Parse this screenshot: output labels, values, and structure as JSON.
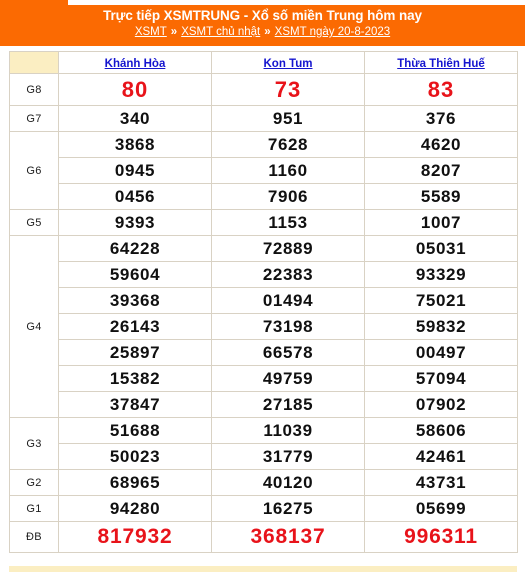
{
  "banner": {
    "title": "Trực tiếp XSMTRUNG - Xổ số miền Trung hôm nay",
    "breadcrumb": [
      {
        "label": "XSMT"
      },
      {
        "label": "XSMT chủ nhật"
      },
      {
        "label": "XSMT ngày 20-8-2023"
      }
    ],
    "separator": "»",
    "background_color": "#fb6a02",
    "text_color": "#ffffff"
  },
  "table": {
    "header": {
      "label_column": "",
      "provinces": [
        "Khánh Hòa",
        "Kon Tum",
        "Thừa Thiên Huế"
      ],
      "background_color": "#fbeec2",
      "link_color": "#1515cf"
    },
    "highlight_color": "#e8131a",
    "prize_rows": [
      {
        "label": "G8",
        "style": "red",
        "values": [
          [
            "80"
          ],
          [
            "73"
          ],
          [
            "83"
          ]
        ]
      },
      {
        "label": "G7",
        "style": "normal",
        "values": [
          [
            "340"
          ],
          [
            "951"
          ],
          [
            "376"
          ]
        ]
      },
      {
        "label": "G6",
        "style": "normal",
        "values": [
          [
            "3868",
            "0945",
            "0456"
          ],
          [
            "7628",
            "1160",
            "7906"
          ],
          [
            "4620",
            "8207",
            "5589"
          ]
        ]
      },
      {
        "label": "G5",
        "style": "normal",
        "values": [
          [
            "9393"
          ],
          [
            "1153"
          ],
          [
            "1007"
          ]
        ]
      },
      {
        "label": "G4",
        "style": "normal",
        "values": [
          [
            "64228",
            "59604",
            "39368",
            "26143",
            "25897",
            "15382",
            "37847"
          ],
          [
            "72889",
            "22383",
            "01494",
            "73198",
            "66578",
            "49759",
            "27185"
          ],
          [
            "05031",
            "93329",
            "75021",
            "59832",
            "00497",
            "57094",
            "07902"
          ]
        ]
      },
      {
        "label": "G3",
        "style": "normal",
        "values": [
          [
            "51688",
            "50023"
          ],
          [
            "11039",
            "31779"
          ],
          [
            "58606",
            "42461"
          ]
        ]
      },
      {
        "label": "G2",
        "style": "normal",
        "values": [
          [
            "68965"
          ],
          [
            "40120"
          ],
          [
            "43731"
          ]
        ]
      },
      {
        "label": "G1",
        "style": "normal",
        "values": [
          [
            "94280"
          ],
          [
            "16275"
          ],
          [
            "05699"
          ]
        ]
      },
      {
        "label": "ĐB",
        "style": "db",
        "values": [
          [
            "817932"
          ],
          [
            "368137"
          ],
          [
            "996311"
          ]
        ]
      }
    ]
  }
}
